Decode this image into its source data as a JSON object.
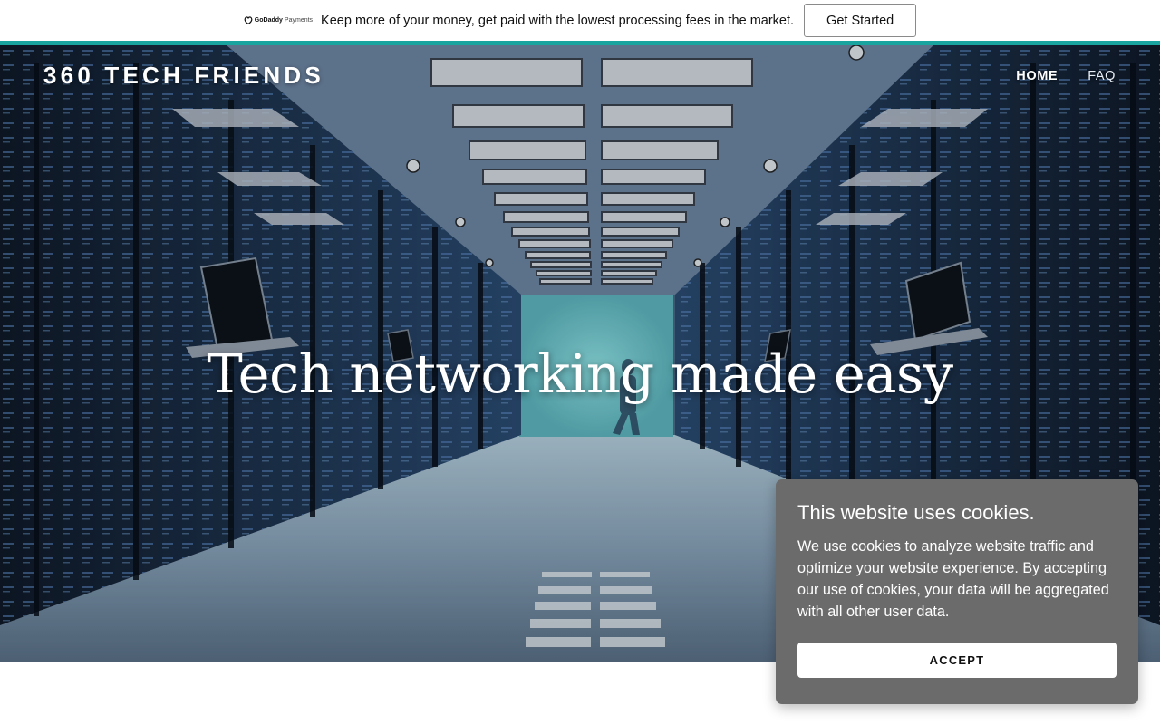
{
  "promo": {
    "logo_bold": "GoDaddy",
    "logo_light": "Payments",
    "message": "Keep more of your money, get paid with the lowest processing fees in the market.",
    "cta_label": "Get Started",
    "bar_color": "#1aa4a0"
  },
  "header": {
    "site_title": "360 TECH FRIENDS",
    "nav": [
      {
        "label": "HOME",
        "active": true
      },
      {
        "label": "FAQ",
        "active": false
      }
    ]
  },
  "hero": {
    "heading": "Tech networking made easy",
    "image": "data-center-server-aisle"
  },
  "cookie_notice": {
    "title": "This website uses cookies.",
    "body": "We use cookies to analyze website traffic and optimize your website experience. By accepting our use of cookies, your data will be aggregated with all other user data.",
    "accept_label": "ACCEPT",
    "panel_color": "#6b6b6b"
  }
}
